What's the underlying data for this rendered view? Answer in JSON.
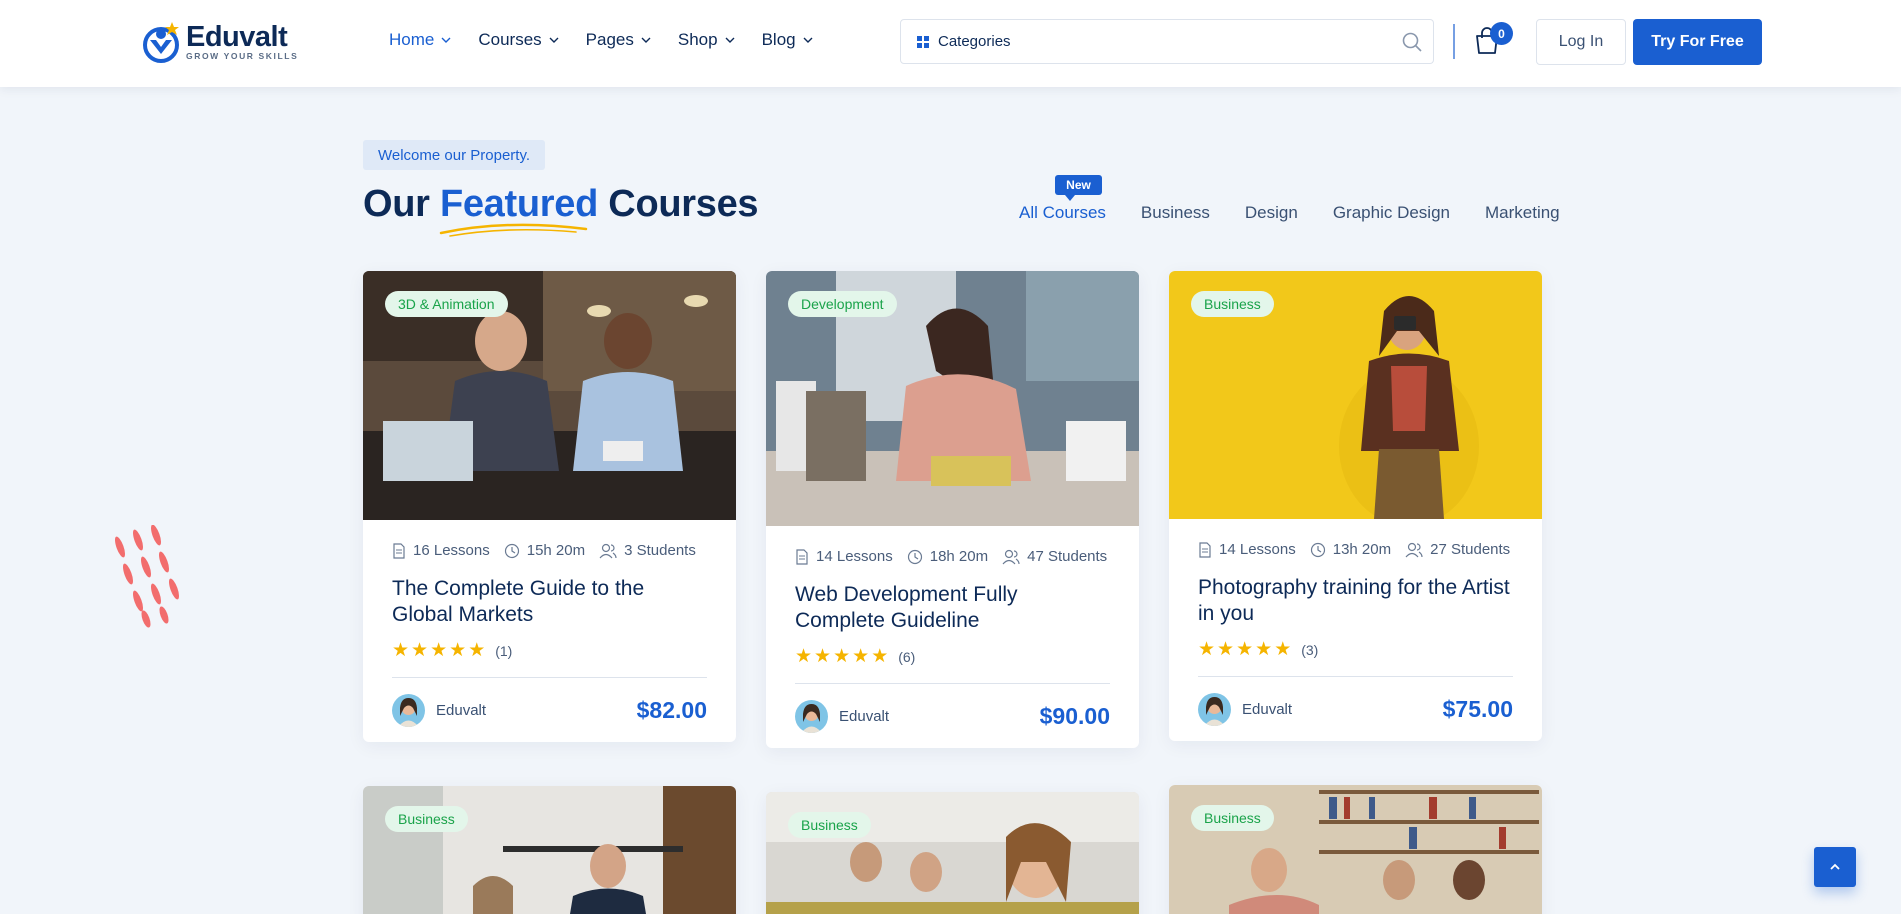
{
  "brand": {
    "name": "Eduvalt",
    "tagline": "GROW YOUR SKILLS"
  },
  "nav": [
    {
      "label": "Home",
      "active": true
    },
    {
      "label": "Courses",
      "active": false
    },
    {
      "label": "Pages",
      "active": false
    },
    {
      "label": "Shop",
      "active": false
    },
    {
      "label": "Blog",
      "active": false
    }
  ],
  "search": {
    "categories_label": "Categories",
    "placeholder": "",
    "value": ""
  },
  "cart": {
    "count": "0"
  },
  "auth": {
    "login_label": "Log In",
    "try_label": "Try For Free"
  },
  "section": {
    "kicker": "Welcome our Property.",
    "title_pre": "Our",
    "title_highlight": "Featured",
    "title_post": "Courses",
    "new_badge": "New",
    "filters": [
      "All Courses",
      "Business",
      "Design",
      "Graphic Design",
      "Marketing"
    ],
    "active_filter": "All Courses"
  },
  "courses": [
    {
      "tag": "3D & Animation",
      "lessons": "16 Lessons",
      "duration": "15h 20m",
      "students": "3 Students",
      "title": "The Complete Guide to the Global Markets",
      "rating": 5,
      "reviews": "(1)",
      "author": "Eduvalt",
      "price": "$82.00"
    },
    {
      "tag": "Development",
      "lessons": "14 Lessons",
      "duration": "18h 20m",
      "students": "47 Students",
      "title": "Web Development Fully Complete Guideline",
      "rating": 5,
      "reviews": "(6)",
      "author": "Eduvalt",
      "price": "$90.00"
    },
    {
      "tag": "Business",
      "lessons": "14 Lessons",
      "duration": "13h 20m",
      "students": "27 Students",
      "title": "Photography training for the Artist in you",
      "rating": 5,
      "reviews": "(3)",
      "author": "Eduvalt",
      "price": "$75.00"
    },
    {
      "tag": "Business"
    },
    {
      "tag": "Business"
    },
    {
      "tag": "Business"
    }
  ],
  "colors": {
    "primary": "#1a5fd1",
    "navy": "#0d2a57",
    "tag_green": "#1aa34a",
    "star": "#f5b400",
    "bg": "#f1f5fa"
  }
}
